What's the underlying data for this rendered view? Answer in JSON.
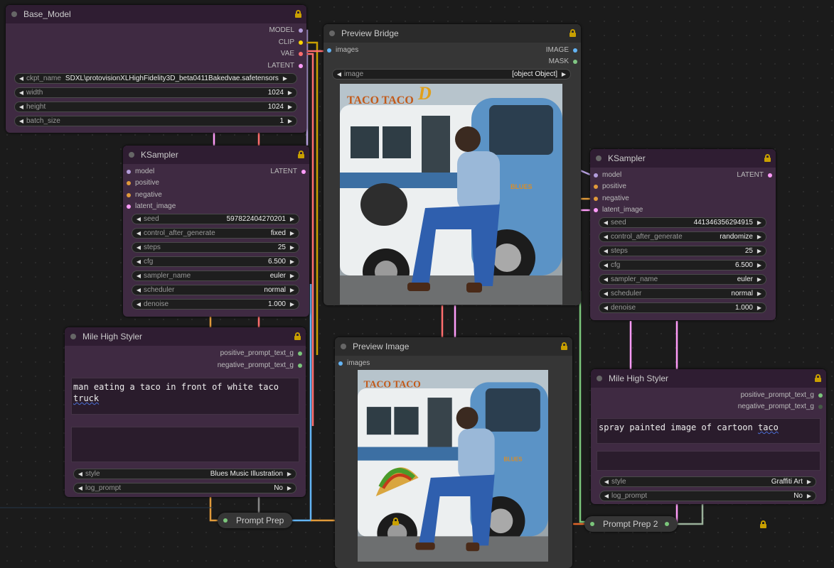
{
  "colors": {
    "model": "#b39ddb",
    "clip": "#ffd500",
    "vae": "#ff6e6e",
    "latent": "#ff9cf9",
    "image": "#64b5f6",
    "mask": "#81c784",
    "string": "#7bc67b",
    "lock": "#c9a000"
  },
  "base_model": {
    "title": "Base_Model",
    "outputs": [
      "MODEL",
      "CLIP",
      "VAE",
      "LATENT"
    ],
    "widgets": [
      {
        "label": "ckpt_name",
        "value": "SDXL\\protovisionXLHighFidelity3D_beta0411Bakedvae.safetensors"
      },
      {
        "label": "width",
        "value": "1024"
      },
      {
        "label": "height",
        "value": "1024"
      },
      {
        "label": "batch_size",
        "value": "1"
      }
    ]
  },
  "ksampler1": {
    "title": "KSampler",
    "inputs": [
      "model",
      "positive",
      "negative",
      "latent_image"
    ],
    "output": "LATENT",
    "widgets": [
      {
        "label": "seed",
        "value": "597822404270201"
      },
      {
        "label": "control_after_generate",
        "value": "fixed"
      },
      {
        "label": "steps",
        "value": "25"
      },
      {
        "label": "cfg",
        "value": "6.500"
      },
      {
        "label": "sampler_name",
        "value": "euler"
      },
      {
        "label": "scheduler",
        "value": "normal"
      },
      {
        "label": "denoise",
        "value": "1.000"
      }
    ]
  },
  "preview_bridge": {
    "title": "Preview Bridge",
    "input": "images",
    "outputs": [
      "IMAGE",
      "MASK"
    ],
    "widget": {
      "label": "image",
      "value": "[object Object]"
    }
  },
  "ksampler2": {
    "title": "KSampler",
    "inputs": [
      "model",
      "positive",
      "negative",
      "latent_image"
    ],
    "output": "LATENT",
    "widgets": [
      {
        "label": "seed",
        "value": "441346356294915"
      },
      {
        "label": "control_after_generate",
        "value": "randomize"
      },
      {
        "label": "steps",
        "value": "25"
      },
      {
        "label": "cfg",
        "value": "6.500"
      },
      {
        "label": "sampler_name",
        "value": "euler"
      },
      {
        "label": "scheduler",
        "value": "normal"
      },
      {
        "label": "denoise",
        "value": "1.000"
      }
    ]
  },
  "styler1": {
    "title": "Mile High Styler",
    "outputs": [
      "positive_prompt_text_g",
      "negative_prompt_text_g"
    ],
    "prompt_a": "man eating a taco in front of white taco",
    "prompt_b": "truck",
    "widgets": [
      {
        "label": "style",
        "value": "Blues Music Illustration"
      },
      {
        "label": "log_prompt",
        "value": "No"
      }
    ]
  },
  "preview_image": {
    "title": "Preview Image",
    "input": "images"
  },
  "styler2": {
    "title": "Mile High Styler",
    "outputs": [
      "positive_prompt_text_g",
      "negative_prompt_text_g"
    ],
    "prompt_a": "spray painted image of cartoon",
    "prompt_b": "taco",
    "widgets": [
      {
        "label": "style",
        "value": "Graffiti Art"
      },
      {
        "label": "log_prompt",
        "value": "No"
      }
    ]
  },
  "prompt_prep1": {
    "title": "Prompt Prep"
  },
  "prompt_prep2": {
    "title": "Prompt Prep 2"
  },
  "image_texts": {
    "sign": "TACO TACO",
    "logo": "BLUES"
  }
}
